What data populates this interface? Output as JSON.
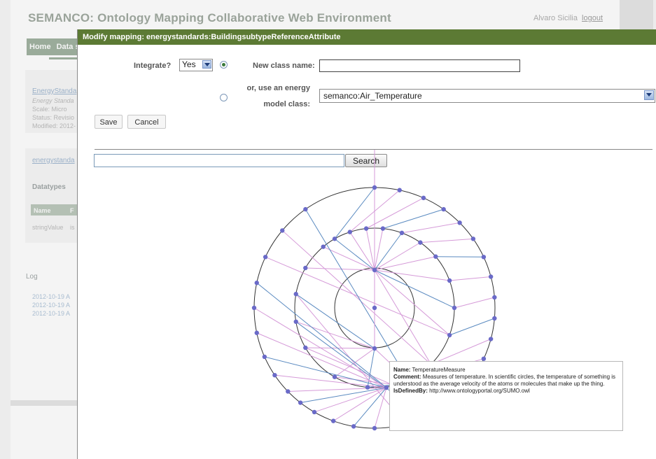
{
  "app": {
    "title": "SEMANCO: Ontology Mapping Collaborative Web Environment",
    "user_name": "Alvaro Sicilia",
    "logout_label": "logout",
    "nav": [
      "Home",
      "Data s"
    ]
  },
  "background": {
    "ontology_panel": {
      "link": "EnergyStanda",
      "subtitle": "Energy Standa",
      "scale": "Scale: Micro",
      "status": "Status: Revisio",
      "modified": "Modified: 2012-"
    },
    "mapping_panel": {
      "link": "energystanda",
      "datatypes_label": "Datatypes",
      "columns": [
        "Name",
        "F"
      ],
      "row": [
        "stringValue",
        "is"
      ]
    },
    "log": {
      "label": "Log",
      "entries": [
        "2012-10-19  A",
        "2012-10-19  A",
        "2012-10-19  A"
      ]
    }
  },
  "dialog": {
    "title": "Modify mapping: energystandards:BuildingsubtypeReferenceAttribute",
    "integrate_label": "Integrate?",
    "integrate_value": "Yes",
    "new_class_label": "New class name:",
    "new_class_value": "",
    "or_label_1": "or, use an energy",
    "or_label_2": "model class:",
    "model_class_value": "semanco:Air_Temperature",
    "save_label": "Save",
    "cancel_label": "Cancel",
    "search_value": "",
    "search_label": "Search",
    "tooltip": {
      "name_label": "Name:",
      "name": "TemperatureMeasure",
      "comment_label": "Comment:",
      "comment": "Measures of temperature. In scientific circles, the temperature of something is understood as the average velocity of the atoms or molecules that make up the thing.",
      "defined_label": "IsDefinedBy:",
      "defined": "http://www.ontologyportal.org/SUMO.owl"
    }
  },
  "colors": {
    "dialog_titlebar": "#5c7a34",
    "graph_node": "#6a6ac8",
    "graph_edge_pink": "#d59ad8",
    "graph_edge_blue": "#5a8ac0"
  }
}
